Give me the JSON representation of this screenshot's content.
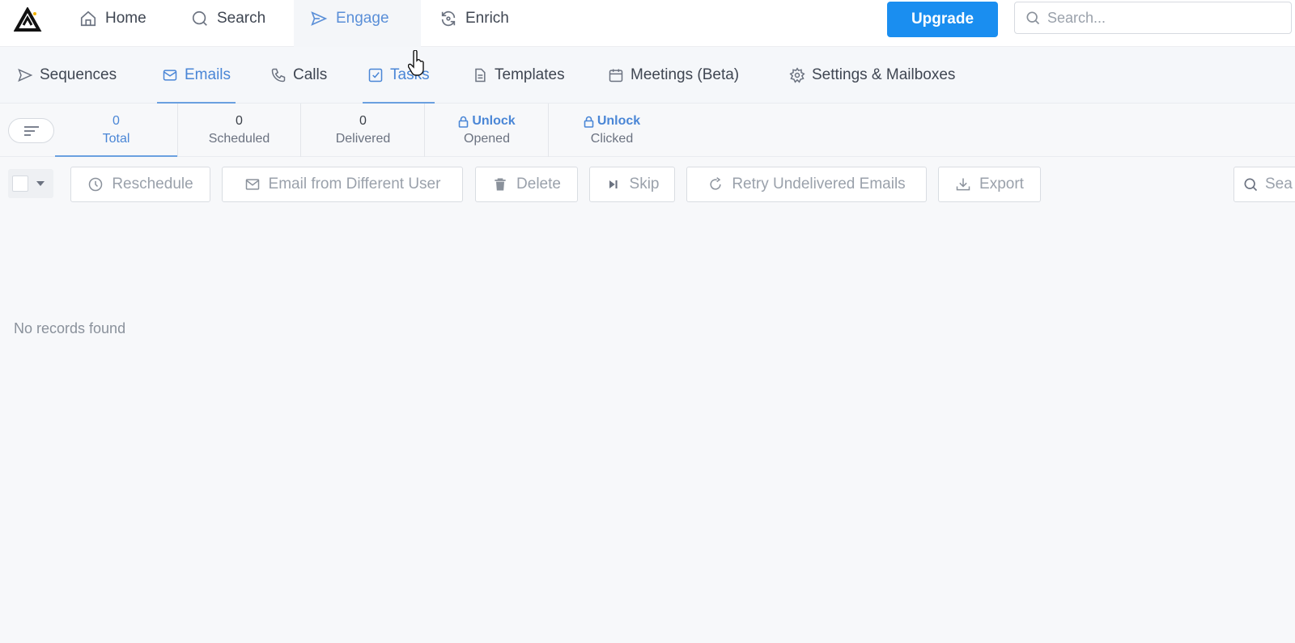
{
  "topnav": {
    "home": "Home",
    "search": "Search",
    "engage": "Engage",
    "enrich": "Enrich",
    "upgrade": "Upgrade",
    "search_placeholder": "Search..."
  },
  "subnav": {
    "sequences": "Sequences",
    "emails": "Emails",
    "calls": "Calls",
    "tasks": "Tasks",
    "templates": "Templates",
    "meetings": "Meetings (Beta)",
    "settings": "Settings & Mailboxes"
  },
  "stats": {
    "total": {
      "value": "0",
      "label": "Total"
    },
    "scheduled": {
      "value": "0",
      "label": "Scheduled"
    },
    "delivered": {
      "value": "0",
      "label": "Delivered"
    },
    "opened": {
      "value": "Unlock",
      "label": "Opened"
    },
    "clicked": {
      "value": "Unlock",
      "label": "Clicked"
    }
  },
  "toolbar": {
    "reschedule": "Reschedule",
    "email_diff_user": "Email from Different User",
    "delete": "Delete",
    "skip": "Skip",
    "retry": "Retry Undelivered Emails",
    "export": "Export",
    "search_partial": "Sea"
  },
  "empty_message": "No records found",
  "colors": {
    "accent": "#1a8ef0",
    "active_link": "#4a86d6",
    "background": "#f7f8fa"
  }
}
